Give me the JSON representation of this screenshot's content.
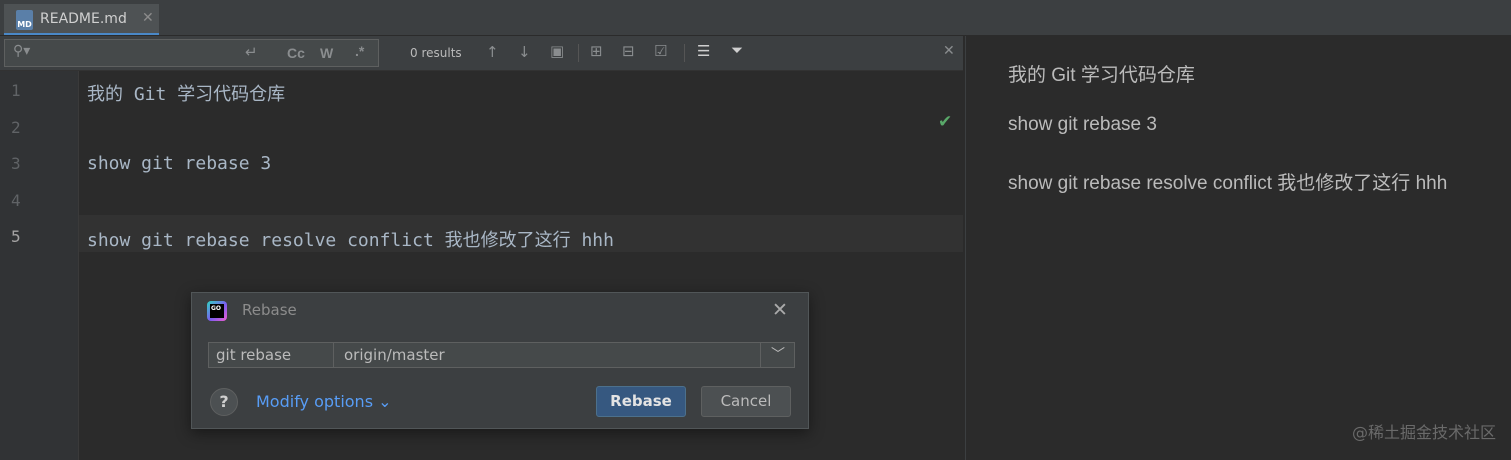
{
  "tab": {
    "label": "README.md",
    "icon": "markdown-file-icon",
    "icon_text": "MD"
  },
  "findbar": {
    "results": "0 results",
    "match_case": "Cc",
    "words": "W",
    "regex": ".*"
  },
  "editor": {
    "line_numbers": [
      "1",
      "2",
      "3",
      "4",
      "5"
    ],
    "lines": [
      "我的 Git 学习代码仓库",
      "",
      "show git rebase 3",
      "",
      "show git rebase resolve conflict 我也修改了这行 hhh"
    ]
  },
  "preview": {
    "paragraphs": [
      "我的 Git 学习代码仓库",
      "show git rebase 3",
      "show git rebase resolve conflict 我也修改了这行 hhh"
    ],
    "watermark": "@稀土掘金技术社区"
  },
  "dialog": {
    "title": "Rebase",
    "logo_text": "GO",
    "command": "git rebase",
    "branch": "origin/master",
    "modify_options": "Modify options ⌄",
    "help": "?",
    "rebase_button": "Rebase",
    "cancel_button": "Cancel"
  },
  "colors": {
    "accent": "#365880",
    "link": "#589df6",
    "background": "#2b2b2b",
    "panel": "#3c3f41",
    "check": "#59a869"
  }
}
